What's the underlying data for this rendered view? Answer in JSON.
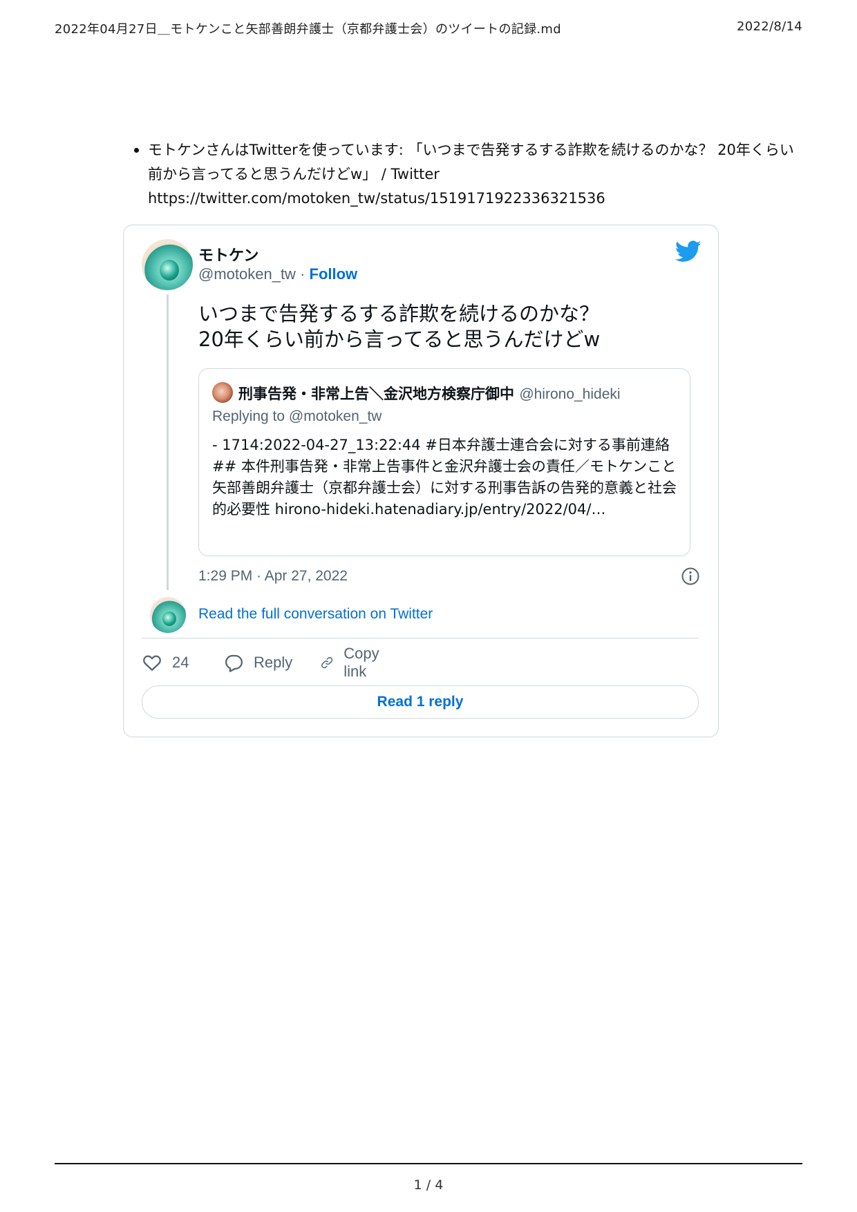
{
  "header": {
    "title": "2022年04月27日＿モトケンこと矢部善朗弁護士（京都弁護士会）のツイートの記録.md",
    "date": "2022/8/14"
  },
  "bullet": {
    "text": "モトケンさんはTwitterを使っています: 「いつまで告発するする詐欺を続けるのかな？ 20年くらい前から言ってると思うんだけどw」 / Twitter",
    "url": "https://twitter.com/motoken_tw/status/1519171922336321536"
  },
  "tweet": {
    "name": "モトケン",
    "handle": "@motoken_tw",
    "separator": " · ",
    "follow_label": "Follow",
    "text_line1": "いつまで告発するする詐欺を続けるのかな？",
    "text_line2": "20年くらい前から言ってると思うんだけどw",
    "quote": {
      "name": "刑事告発・非常上告＼金沢地方検察庁御中",
      "handle": "@hirono_hideki",
      "replying_to": "Replying to @motoken_tw",
      "body": "- 1714:2022-04-27_13:22:44 #日本弁護士連合会に対する事前連絡 ## 本件刑事告発・非常上告事件と金沢弁護士会の責任／モトケンこと矢部善朗弁護士（京都弁護士会）に対する刑事告訴の告発的意義と社会的必要性 hirono-hideki.hatenadiary.jp/entry/2022/04/…"
    },
    "timestamp": "1:29 PM · Apr 27, 2022",
    "read_full_label": "Read the full conversation on Twitter",
    "likes": "24",
    "reply_label": "Reply",
    "copy_label": "Copy link",
    "read_reply_label": "Read 1 reply"
  },
  "footer": {
    "page": "1 / 4"
  },
  "colors": {
    "link_blue": "#006fd6",
    "twitter_blue": "#1d9bf0",
    "muted": "#536471",
    "border": "#cfd9de"
  },
  "icons": [
    "twitter-bird-icon",
    "info-icon",
    "heart-icon",
    "reply-bubble-icon",
    "link-icon"
  ]
}
